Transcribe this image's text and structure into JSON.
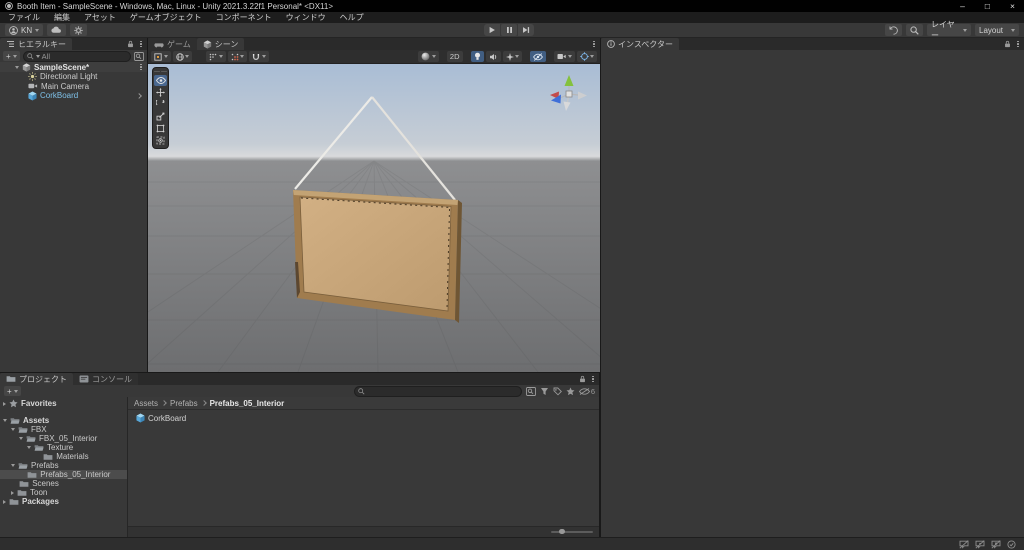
{
  "window": {
    "title": "Booth Item - SampleScene - Windows, Mac, Linux - Unity 2021.3.22f1 Personal* <DX11>",
    "minimize": "–",
    "restore": "□",
    "close": "×"
  },
  "menu_bar": {
    "items": [
      "ファイル",
      "編集",
      "アセット",
      "ゲームオブジェクト",
      "コンポーネント",
      "ウィンドウ",
      "ヘルプ"
    ]
  },
  "toolbar": {
    "account_label": "KN",
    "layers_label": "レイヤー",
    "layout_label": "Layout"
  },
  "hierarchy": {
    "tab_label": "ヒエラルキー",
    "create_label": "+",
    "search_text": "All",
    "scene_label": "SampleScene*",
    "items": [
      {
        "label": "Directional Light",
        "icon": "light"
      },
      {
        "label": "Main Camera",
        "icon": "camera"
      },
      {
        "label": "CorkBoard",
        "icon": "prefab",
        "prefab": true
      }
    ]
  },
  "scene_panel": {
    "tab_game": "ゲーム",
    "tab_scene": "シーン",
    "btn_2d": "2D"
  },
  "inspector": {
    "tab_label": "インスペクター"
  },
  "project": {
    "tab_project": "プロジェクト",
    "tab_console": "コンソール",
    "create_label": "+",
    "hidden_count": "6",
    "breadcrumb": [
      "Assets",
      "Prefabs",
      "Prefabs_05_Interior"
    ],
    "tree": [
      {
        "label": "Favorites",
        "depth": 0,
        "bold": true,
        "arrow": "collapsed",
        "icon": "star",
        "gap_after": true
      },
      {
        "label": "Assets",
        "depth": 0,
        "bold": true,
        "arrow": "expanded",
        "icon": "folder-open"
      },
      {
        "label": "FBX",
        "depth": 1,
        "arrow": "expanded",
        "icon": "folder-open"
      },
      {
        "label": "FBX_05_Interior",
        "depth": 2,
        "arrow": "expanded",
        "icon": "folder-open"
      },
      {
        "label": "Texture",
        "depth": 3,
        "arrow": "expanded",
        "icon": "folder-open"
      },
      {
        "label": "Materials",
        "depth": 4,
        "arrow": "none",
        "icon": "folder"
      },
      {
        "label": "Prefabs",
        "depth": 1,
        "arrow": "expanded",
        "icon": "folder-open"
      },
      {
        "label": "Prefabs_05_Interior",
        "depth": 2,
        "arrow": "none",
        "icon": "folder",
        "selected": true
      },
      {
        "label": "Scenes",
        "depth": 1,
        "arrow": "none",
        "icon": "folder"
      },
      {
        "label": "Toon",
        "depth": 1,
        "arrow": "collapsed",
        "icon": "folder"
      },
      {
        "label": "Packages",
        "depth": 0,
        "bold": true,
        "arrow": "collapsed",
        "icon": "folder"
      }
    ],
    "items": [
      {
        "label": "CorkBoard",
        "icon": "prefab"
      }
    ]
  },
  "colors": {
    "prefab_blue": "#7fc1e8",
    "selection_gray": "#4c4c4c",
    "scene_highlight_blue": "#415e82",
    "cork_tan": "#c9a77b",
    "frame_brown": "#a07c4e"
  }
}
